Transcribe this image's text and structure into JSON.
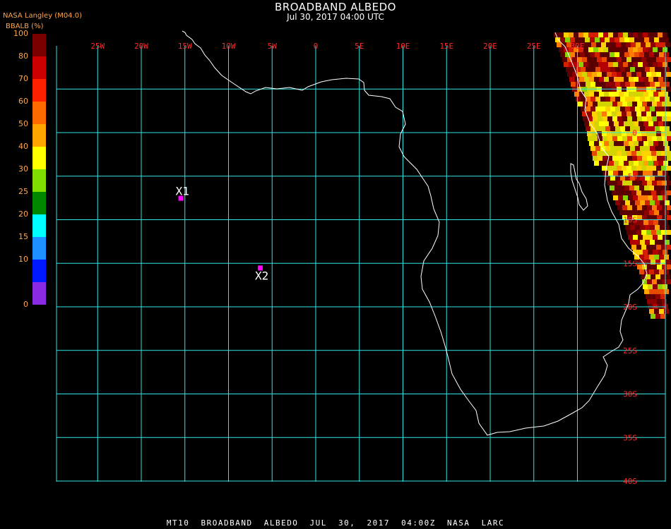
{
  "header": {
    "title": "BROADBAND ALBEDO",
    "subtitle": "Jul 30, 2017 04:00 UTC",
    "source": "NASA Langley (M04.0)"
  },
  "colorbar": {
    "title": "BBALB (%)",
    "levels": [
      "100",
      "80",
      "70",
      "60",
      "50",
      "40",
      "30",
      "25",
      "20",
      "15",
      "10",
      "0"
    ],
    "colors": [
      "#7a0000",
      "#cc0000",
      "#ff2000",
      "#ff6a00",
      "#ffa500",
      "#ffff00",
      "#7fdf00",
      "#008800",
      "#00ffff",
      "#1e90ff",
      "#0018ff",
      "#8a2be2"
    ]
  },
  "map": {
    "longitude_ticks": [
      "25W",
      "20W",
      "15W",
      "10W",
      "5W",
      "0",
      "5E",
      "10E",
      "15E",
      "20E",
      "25E",
      "30E"
    ],
    "latitude_ticks": [
      "0",
      "5S",
      "10S",
      "15S",
      "20S",
      "25S",
      "30S",
      "35S",
      "40S"
    ],
    "grid_color": "#2ee6e6",
    "coast_color": "#ffffff",
    "marker_color": "#ff00ff",
    "markers": [
      {
        "label": "X1",
        "lon": "15.5W",
        "lat": "7.5S"
      },
      {
        "label": "X2",
        "lon": "6.4W",
        "lat": "15.5S"
      }
    ]
  },
  "footer": {
    "text": "MT10 BROADBAND ALBEDO JUL 30, 2017 04:00Z NASA LARC"
  }
}
